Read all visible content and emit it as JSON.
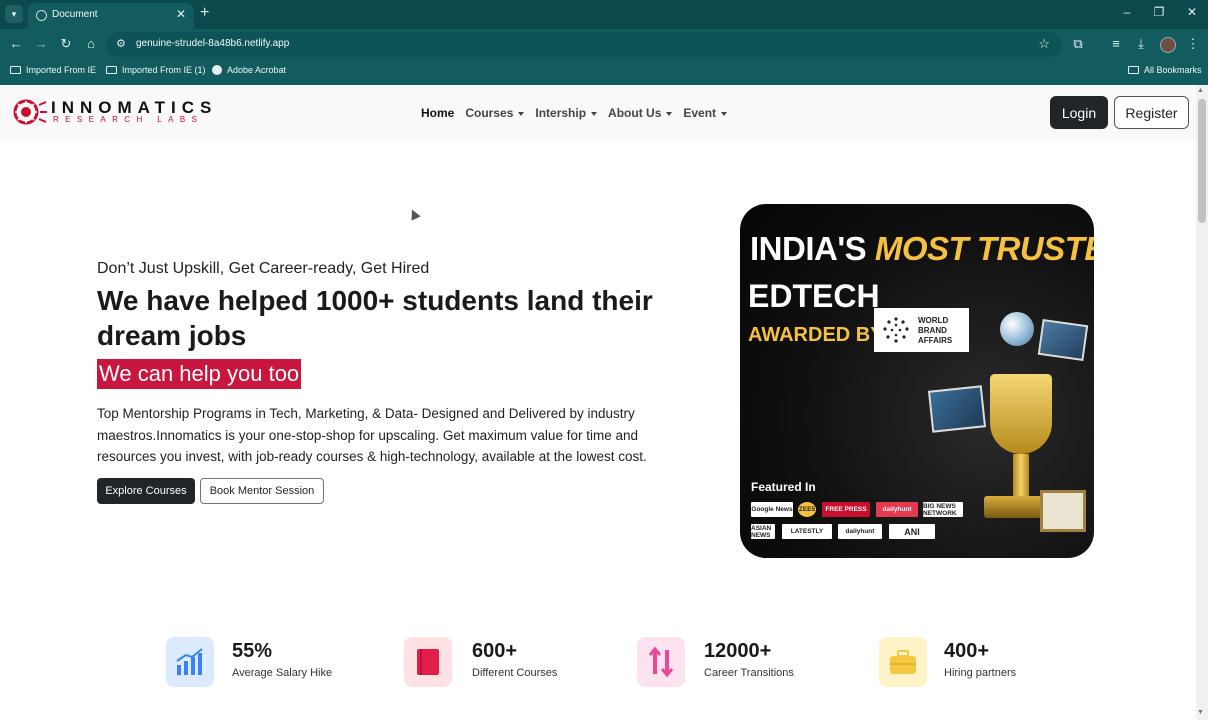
{
  "browser": {
    "tab_title": "Document",
    "url": "genuine-strudel-8a48b6.netlify.app",
    "bookmarks": [
      "Imported From IE",
      "Imported From IE (1)",
      "Adobe Acrobat"
    ],
    "all_bookmarks": "All Bookmarks"
  },
  "nav": {
    "logo_title": "INNOMATICS",
    "logo_sub": "RESEARCH LABS",
    "items": [
      {
        "label": "Home",
        "active": true,
        "dropdown": false
      },
      {
        "label": "Courses",
        "active": false,
        "dropdown": true
      },
      {
        "label": "Intership",
        "active": false,
        "dropdown": true
      },
      {
        "label": "About Us",
        "active": false,
        "dropdown": true
      },
      {
        "label": "Event",
        "active": false,
        "dropdown": true
      }
    ],
    "login": "Login",
    "register": "Register"
  },
  "hero": {
    "kicker": "Don’t Just Upskill, Get Career-ready, Get Hired",
    "title": "We have helped 1000+ students land their dream jobs",
    "highlight": "We can help you too",
    "description": "Top Mentorship Programs in Tech, Marketing, & Data- Designed and Delivered by industry maestros.Innomatics is your one-stop-shop for upscaling. Get maximum value for time and resources you invest, with job-ready courses & high-technology, available at the lowest cost.",
    "primary_button": "Explore Courses",
    "secondary_button": "Book Mentor Session"
  },
  "banner": {
    "line1_plain": "INDIA'S ",
    "line1_gold": "MOST TRUSTED",
    "line2": "EDTECH",
    "line3": "AWARDED BY",
    "award_org": "WORLD BRAND AFFAIRS",
    "award_org_lines": [
      "WORLD",
      "BRAND",
      "AFFAIRS"
    ],
    "featured_label": "Featured In",
    "featured_logos": [
      "Google News",
      "ZEE5",
      "FREE PRESS",
      "dailyhunt",
      "BIG NEWS NETWORK",
      "ASIAN NEWS",
      "LATESTLY",
      "dailyhunt",
      "ANI"
    ]
  },
  "stats": [
    {
      "value": "55%",
      "label": "Average Salary Hike",
      "icon": "chart-icon",
      "color": "#dbeafe"
    },
    {
      "value": "600+",
      "label": "Different Courses",
      "icon": "book-icon",
      "color": "#fde2e4"
    },
    {
      "value": "12000+",
      "label": "Career Transitions",
      "icon": "transition-icon",
      "color": "#fde2ef"
    },
    {
      "value": "400+",
      "label": "Hiring partners",
      "icon": "briefcase-icon",
      "color": "#fef3c7"
    }
  ],
  "colors": {
    "brand_red": "#c8163e",
    "dark_button": "#212529",
    "banner_gold": "#f6c141",
    "browser_teal": "#125c60"
  }
}
